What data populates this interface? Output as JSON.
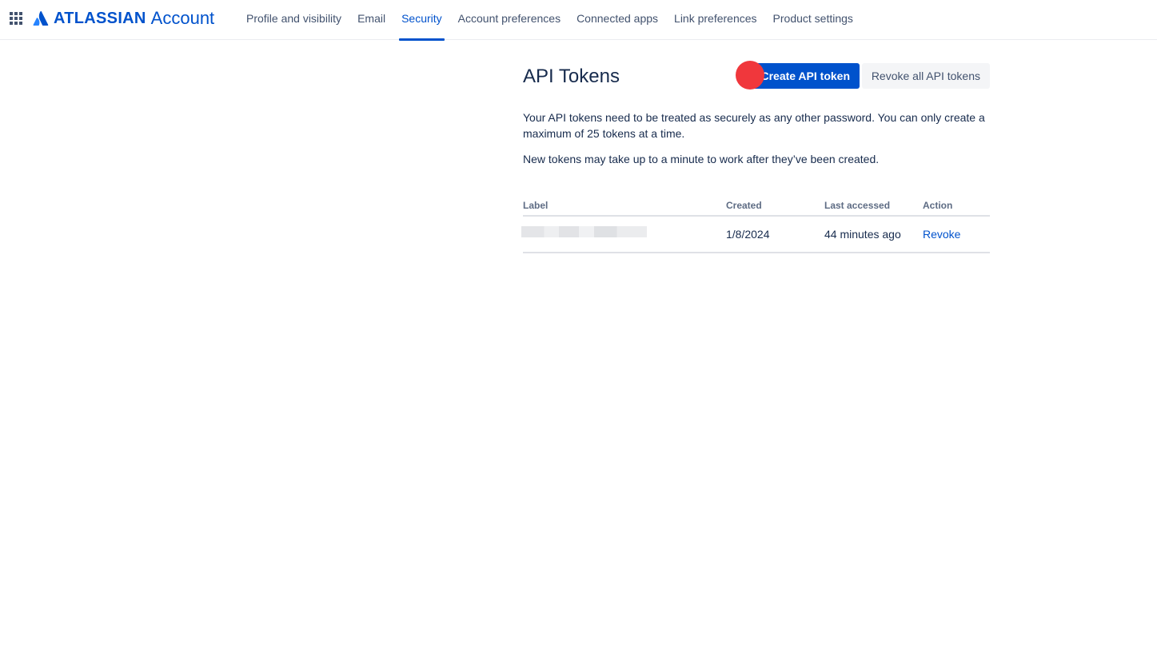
{
  "header": {
    "app_switcher_icon": "grid-icon",
    "logo_brand": "ATLASSIAN",
    "logo_product": "Account",
    "brand_color": "#0052cc",
    "nav": [
      {
        "label": "Profile and visibility",
        "active": false
      },
      {
        "label": "Email",
        "active": false
      },
      {
        "label": "Security",
        "active": true
      },
      {
        "label": "Account preferences",
        "active": false
      },
      {
        "label": "Connected apps",
        "active": false
      },
      {
        "label": "Link preferences",
        "active": false
      },
      {
        "label": "Product settings",
        "active": false
      }
    ]
  },
  "main": {
    "title": "API Tokens",
    "create_button": "Create API token",
    "revoke_all_button": "Revoke all API tokens",
    "description_1": "Your API tokens need to be treated as securely as any other password. You can only create a maximum of 25 tokens at a time.",
    "description_2": "New tokens may take up to a minute to work after they’ve been created.",
    "table": {
      "headers": {
        "label": "Label",
        "created": "Created",
        "last_accessed": "Last accessed",
        "action": "Action"
      },
      "rows": [
        {
          "label": "",
          "label_redacted": true,
          "created": "1/8/2024",
          "last_accessed": "44 minutes ago",
          "action": "Revoke"
        }
      ]
    }
  },
  "colors": {
    "primary": "#0052cc",
    "click_marker": "#f0373c"
  }
}
